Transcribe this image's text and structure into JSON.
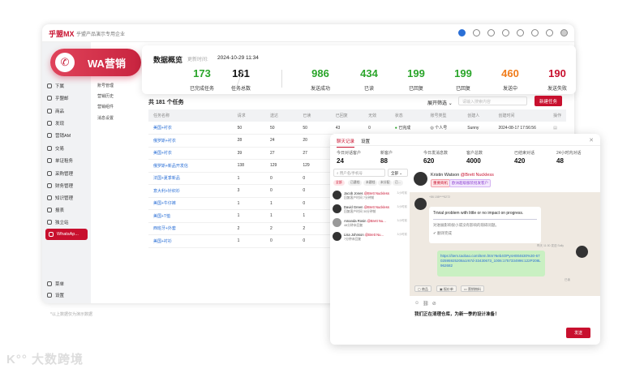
{
  "app": {
    "logo": "乎盟MX",
    "company": "乎盟产品演示专用企业",
    "footnote": "*以上数据仅为演示数据",
    "watermark": "大数跨境"
  },
  "badge": {
    "label": "WA营销"
  },
  "sidebar": {
    "items": [
      "下属",
      "乎盟邮",
      "商品",
      "发现",
      "营销AM",
      "交易",
      "单证租务",
      "采购管理",
      "财务管理",
      "知识管理",
      "报表",
      "独立站",
      "WhatsAp..."
    ],
    "bottom": [
      "菜单",
      "设置"
    ]
  },
  "submenu": [
    "账号管理",
    "营销历史",
    "营销组件",
    "消息设置"
  ],
  "overview": {
    "title": "数据概览",
    "updated_label": "更新时间:",
    "updated": "2024-10-29 11:34",
    "stats": [
      {
        "value": "173",
        "label": "已完成任务",
        "color": "#2aa52a"
      },
      {
        "value": "181",
        "label": "任务总数",
        "color": "#111"
      },
      {
        "value": "986",
        "label": "发送成功",
        "color": "#2aa52a"
      },
      {
        "value": "434",
        "label": "已读",
        "color": "#2aa52a"
      },
      {
        "value": "199",
        "label": "已回复",
        "color": "#2aa52a"
      },
      {
        "value": "199",
        "label": "已回复",
        "color": "#2aa52a"
      },
      {
        "value": "460",
        "label": "发送中",
        "color": "#f07c1a"
      },
      {
        "value": "190",
        "label": "发送失败",
        "color": "#c8102e"
      }
    ]
  },
  "tasks": {
    "title": "共 181 个任务",
    "filter": "展开筛选",
    "search_placeholder": "请输入搜索内容",
    "new_button": "新建任务",
    "columns": [
      "任务名称",
      "请求",
      "送达",
      "已读",
      "已回复",
      "无效",
      "状态",
      "账号类型",
      "创建人",
      "创建时间",
      "操作"
    ],
    "rows": [
      [
        "美国+衬衣",
        "50",
        "50",
        "50",
        "43",
        "0",
        "已完成",
        "个人号",
        "Sunny",
        "2024-08-17 17:56:56",
        ""
      ],
      [
        "俄罗斯+衬衣",
        "28",
        "24",
        "20",
        "19"
      ],
      [
        "美国+衬衣",
        "39",
        "27",
        "27",
        "13"
      ],
      [
        "俄罗斯+新品开发信",
        "138",
        "129",
        "129",
        "71"
      ],
      [
        "法国+夏季新品",
        "1",
        "0",
        "0",
        "0"
      ],
      [
        "意大利+针织衫",
        "3",
        "0",
        "0",
        "0"
      ],
      [
        "美国+牛仔裤",
        "1",
        "1",
        "0",
        "0"
      ],
      [
        "美国+T恤",
        "1",
        "1",
        "1",
        "1"
      ],
      [
        "西班牙+外套",
        "2",
        "2",
        "2",
        "1"
      ],
      [
        "美国+衬衫",
        "1",
        "0",
        "0",
        "0"
      ]
    ]
  },
  "chat": {
    "tabs": [
      "聊天记录",
      "设置"
    ],
    "stats": [
      {
        "label": "今日对话客户",
        "value": "24"
      },
      {
        "label": "新客户",
        "value": "88"
      },
      {
        "label": "今日发消息数",
        "value": "620"
      },
      {
        "label": "客户总数",
        "value": "4000"
      },
      {
        "label": "已结束对话",
        "value": "420"
      },
      {
        "label": "24小时内对话",
        "value": "48"
      }
    ],
    "search_placeholder": "用户名/手机号",
    "select": "全部",
    "chips": [
      "全部",
      "已建档",
      "未建档",
      "未分配",
      "已..."
    ],
    "contacts": [
      {
        "name": "Jacob Jones",
        "at": "@Brett Nuckless",
        "sub": "回复客户时间 7分钟前",
        "time": "3小时前"
      },
      {
        "name": "David Green",
        "at": "@Brett Nuckless",
        "sub": "回复客户时间 30分钟前",
        "time": "3小时前"
      },
      {
        "name": "Amanda Rosin",
        "at": "@Brett Nu...",
        "sub": "48分钟未回复",
        "time": "3小时前"
      },
      {
        "name": "Lisa Johnson",
        "at": "@Brett Nu...",
        "sub": "7分钟未回复",
        "time": "3小时前"
      }
    ],
    "header": {
      "name": "Kristin Watson",
      "at": "@Brett Nuckless",
      "tags": [
        "重要商机",
        "欧洲超级服装批发客户"
      ]
    },
    "incoming": {
      "phone": "+86 158****5272",
      "text": "Trivial problem with little or no impact on progress.",
      "translation": "对进展影响很小或没有影响的琐碎问题。",
      "status": "翻译完成"
    },
    "outgoing": {
      "meta": "昨天 11:30 发送 Sally",
      "text": "https://item.taobao.com/item.htm?6eb4OPysH004630%30-6702595925208a1r67d-33430673_1006:1757334996:122P208L962682",
      "status": "已读"
    },
    "tools": [
      "商品",
      "报价单",
      "营销物料"
    ],
    "input": "我们正在清理仓库，为新一季的设计准备！",
    "send": "发送"
  }
}
